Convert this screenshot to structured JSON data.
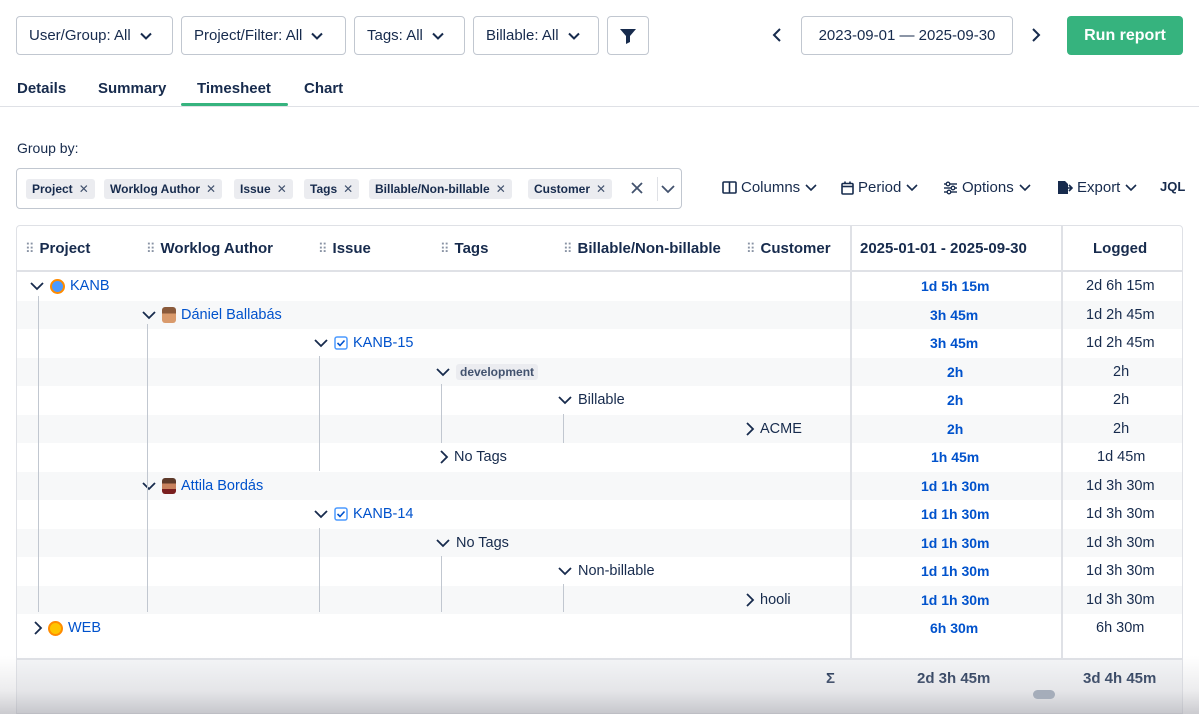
{
  "filters": {
    "user_group": "User/Group: All",
    "project_filter": "Project/Filter: All",
    "tags": "Tags: All",
    "billable": "Billable: All"
  },
  "date_range": "2023-09-01 — 2025-09-30",
  "run_report": "Run report",
  "tabs": [
    "Details",
    "Summary",
    "Timesheet",
    "Chart"
  ],
  "active_tab": "Timesheet",
  "group_by": {
    "label": "Group by:",
    "chips": [
      "Project",
      "Worklog Author",
      "Issue",
      "Tags",
      "Billable/Non-billable",
      "Customer"
    ]
  },
  "toolbar": {
    "columns": "Columns",
    "period": "Period",
    "options": "Options",
    "export": "Export",
    "jql": "JQL"
  },
  "table": {
    "headers": [
      "Project",
      "Worklog Author",
      "Issue",
      "Tags",
      "Billable/Non-billable",
      "Customer"
    ],
    "period_header": "2025-01-01 - 2025-09-30",
    "logged_header": "Logged",
    "rows": [
      {
        "label": "KANB",
        "period": "1d 5h 15m",
        "logged": "2d 6h 15m"
      },
      {
        "label": "Dániel Ballabás",
        "period": "3h 45m",
        "logged": "1d 2h 45m"
      },
      {
        "label": "KANB-15",
        "period": "3h 45m",
        "logged": "1d 2h 45m"
      },
      {
        "label": "development",
        "period": "2h",
        "logged": "2h"
      },
      {
        "label": "Billable",
        "period": "2h",
        "logged": "2h"
      },
      {
        "label": "ACME",
        "period": "2h",
        "logged": "2h"
      },
      {
        "label": "No Tags",
        "period": "1h 45m",
        "logged": "1d 45m"
      },
      {
        "label": "Attila Bordás",
        "period": "1d 1h 30m",
        "logged": "1d 3h 30m"
      },
      {
        "label": "KANB-14",
        "period": "1d 1h 30m",
        "logged": "1d 3h 30m"
      },
      {
        "label": "No Tags",
        "period": "1d 1h 30m",
        "logged": "1d 3h 30m"
      },
      {
        "label": "Non-billable",
        "period": "1d 1h 30m",
        "logged": "1d 3h 30m"
      },
      {
        "label": "hooli",
        "period": "1d 1h 30m",
        "logged": "1d 3h 30m"
      },
      {
        "label": "WEB",
        "period": "6h 30m",
        "logged": "6h 30m"
      }
    ],
    "footer": {
      "sigma": "Σ",
      "period_total": "2d 3h 45m",
      "logged_total": "3d 4h 45m"
    }
  },
  "colors": {
    "accent": "#36b37e",
    "link": "#0052cc"
  }
}
